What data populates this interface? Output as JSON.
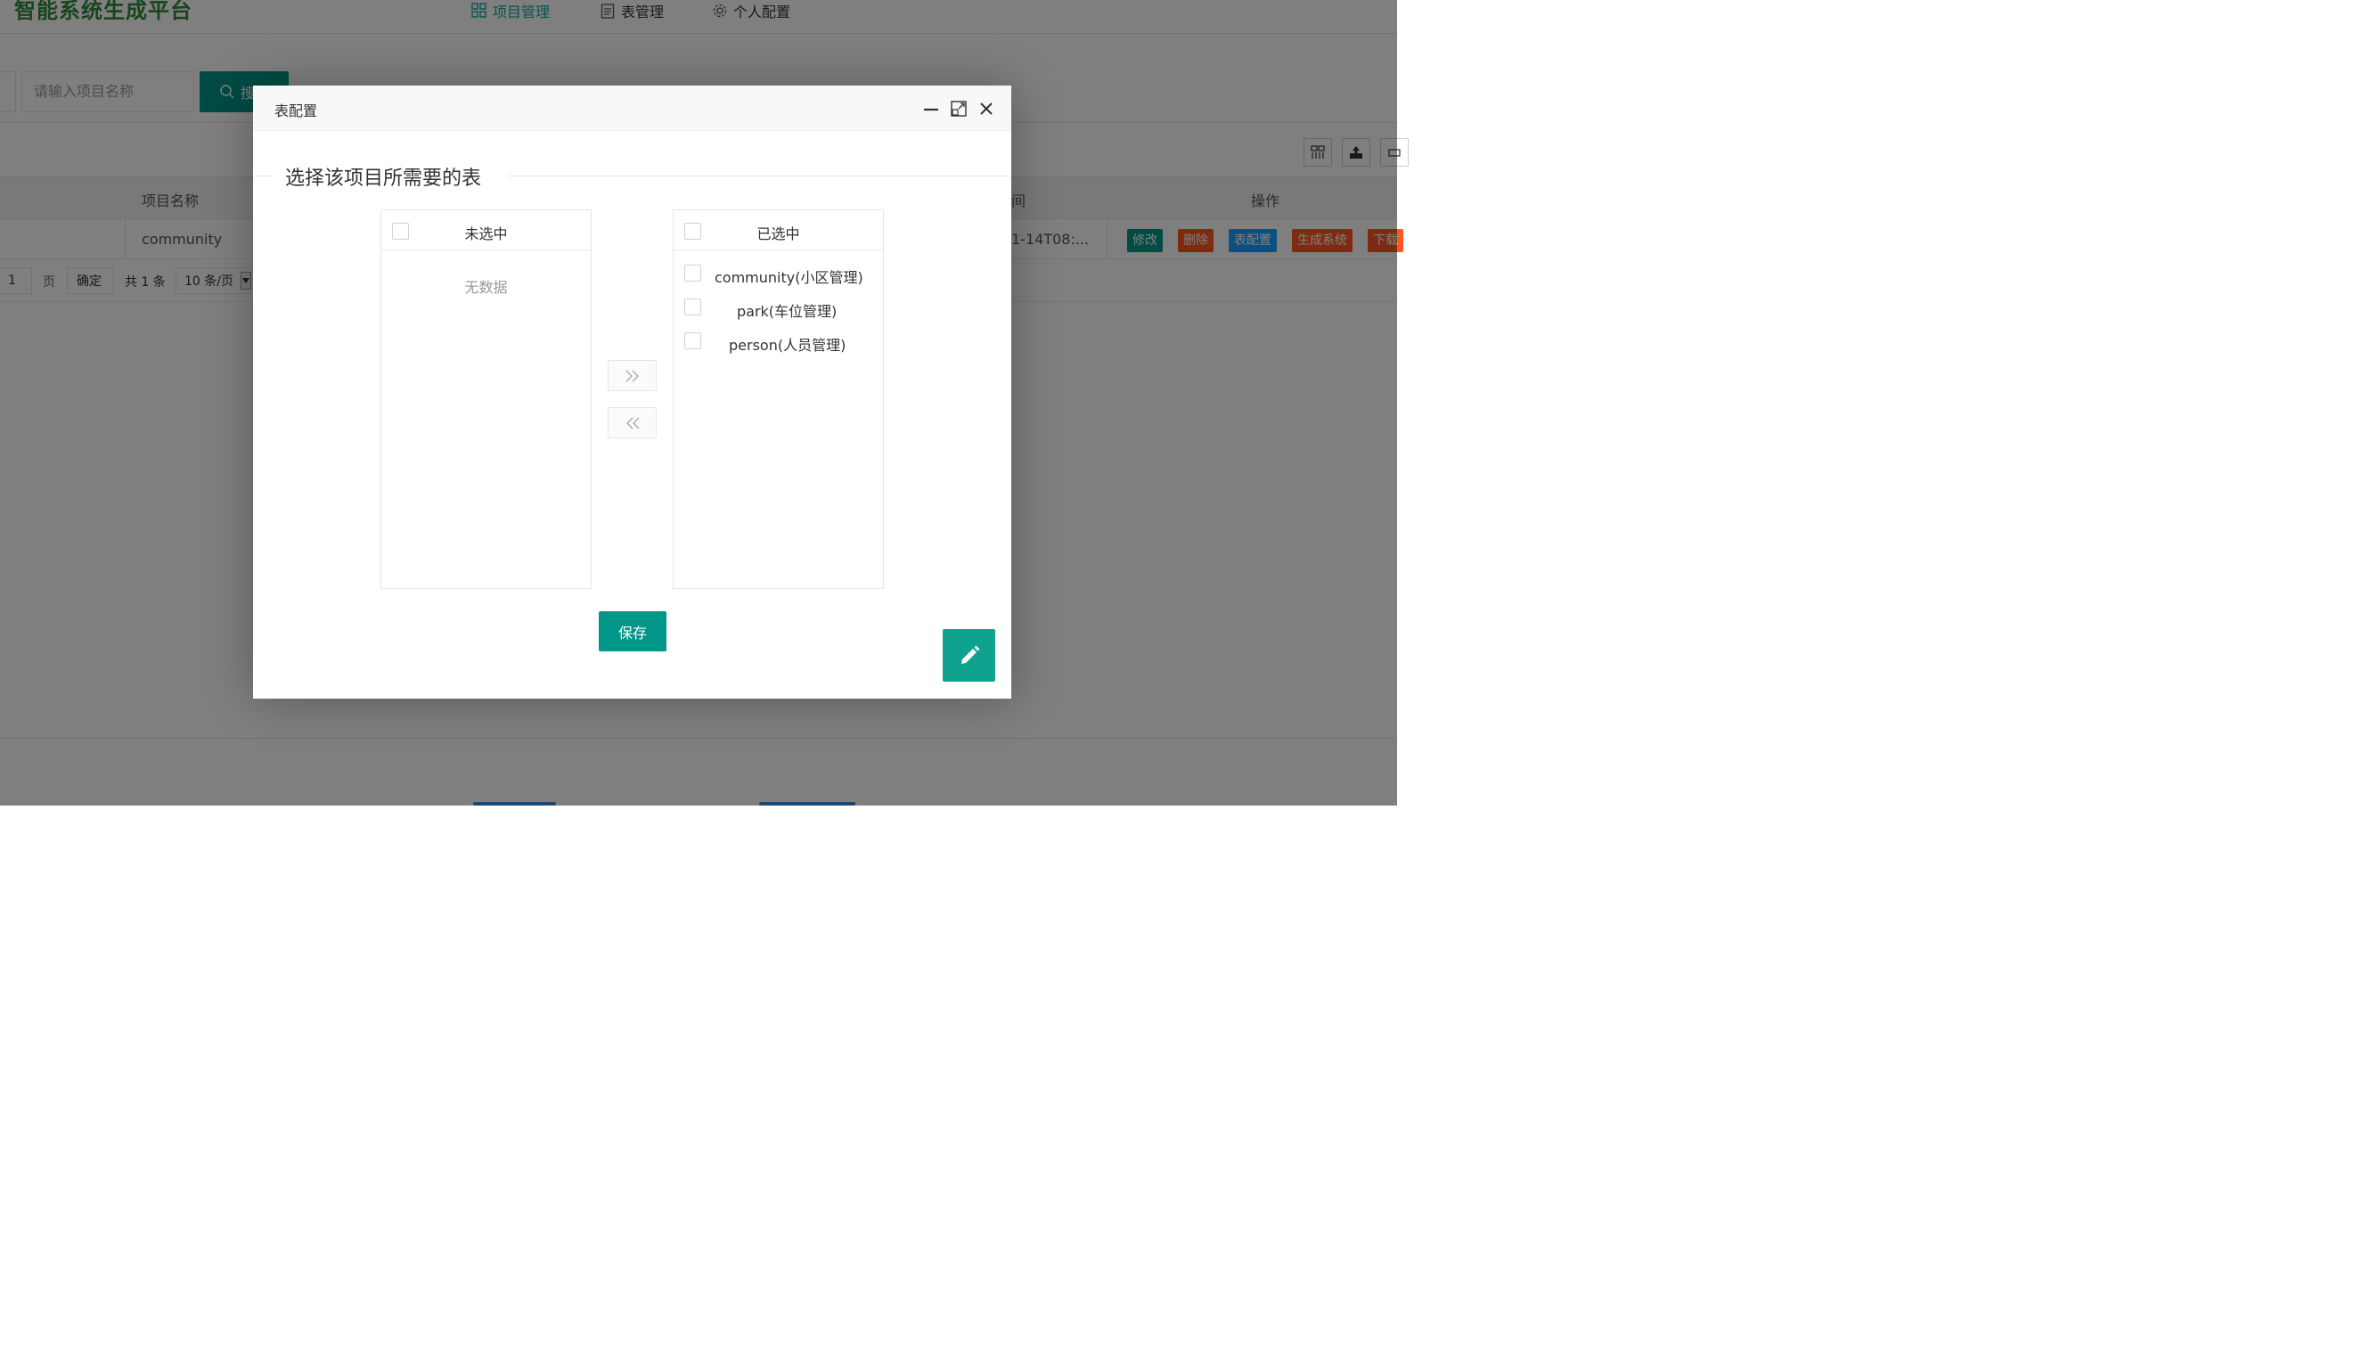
{
  "app": {
    "title": "智能系统生成平台",
    "nav": [
      {
        "label": "项目管理",
        "icon": "grid-icon",
        "active": true
      },
      {
        "label": "表管理",
        "icon": "clipboard-icon",
        "active": false
      },
      {
        "label": "个人配置",
        "icon": "gear-icon",
        "active": false
      }
    ]
  },
  "search": {
    "placeholder": "请输入项目名称",
    "button_label": "搜"
  },
  "table": {
    "headers": {
      "name": "项目名称",
      "time_fragment": "间",
      "actions": "操作"
    },
    "rows": [
      {
        "name": "community",
        "time": "1-14T08:..."
      }
    ],
    "row_actions": [
      {
        "label": "修改",
        "color": "#009688"
      },
      {
        "label": "删除",
        "color": "#ff5722"
      },
      {
        "label": "表配置",
        "color": "#1e9fff"
      },
      {
        "label": "生成系统",
        "color": "#ff5722"
      },
      {
        "label": "下载",
        "color": "#ff5722"
      }
    ]
  },
  "pager": {
    "page_value": "1",
    "page_label": "页",
    "confirm_label": "确定",
    "total_label": "共 1 条",
    "page_size_label": "10 条/页"
  },
  "modal": {
    "title": "表配置",
    "legend": "选择该项目所需要的表",
    "left_box": {
      "title": "未选中",
      "empty_text": "无数据",
      "items": []
    },
    "right_box": {
      "title": "已选中",
      "items": [
        {
          "label": "community(小区管理)"
        },
        {
          "label": "park(车位管理)"
        },
        {
          "label": "person(人员管理)"
        }
      ]
    },
    "transfer_right_symbol": "»",
    "transfer_left_symbol": "«",
    "save_label": "保存"
  },
  "colors": {
    "primary": "#009688",
    "danger": "#ff5722",
    "info": "#1e9fff",
    "brand_text": "#2e8b3a"
  }
}
